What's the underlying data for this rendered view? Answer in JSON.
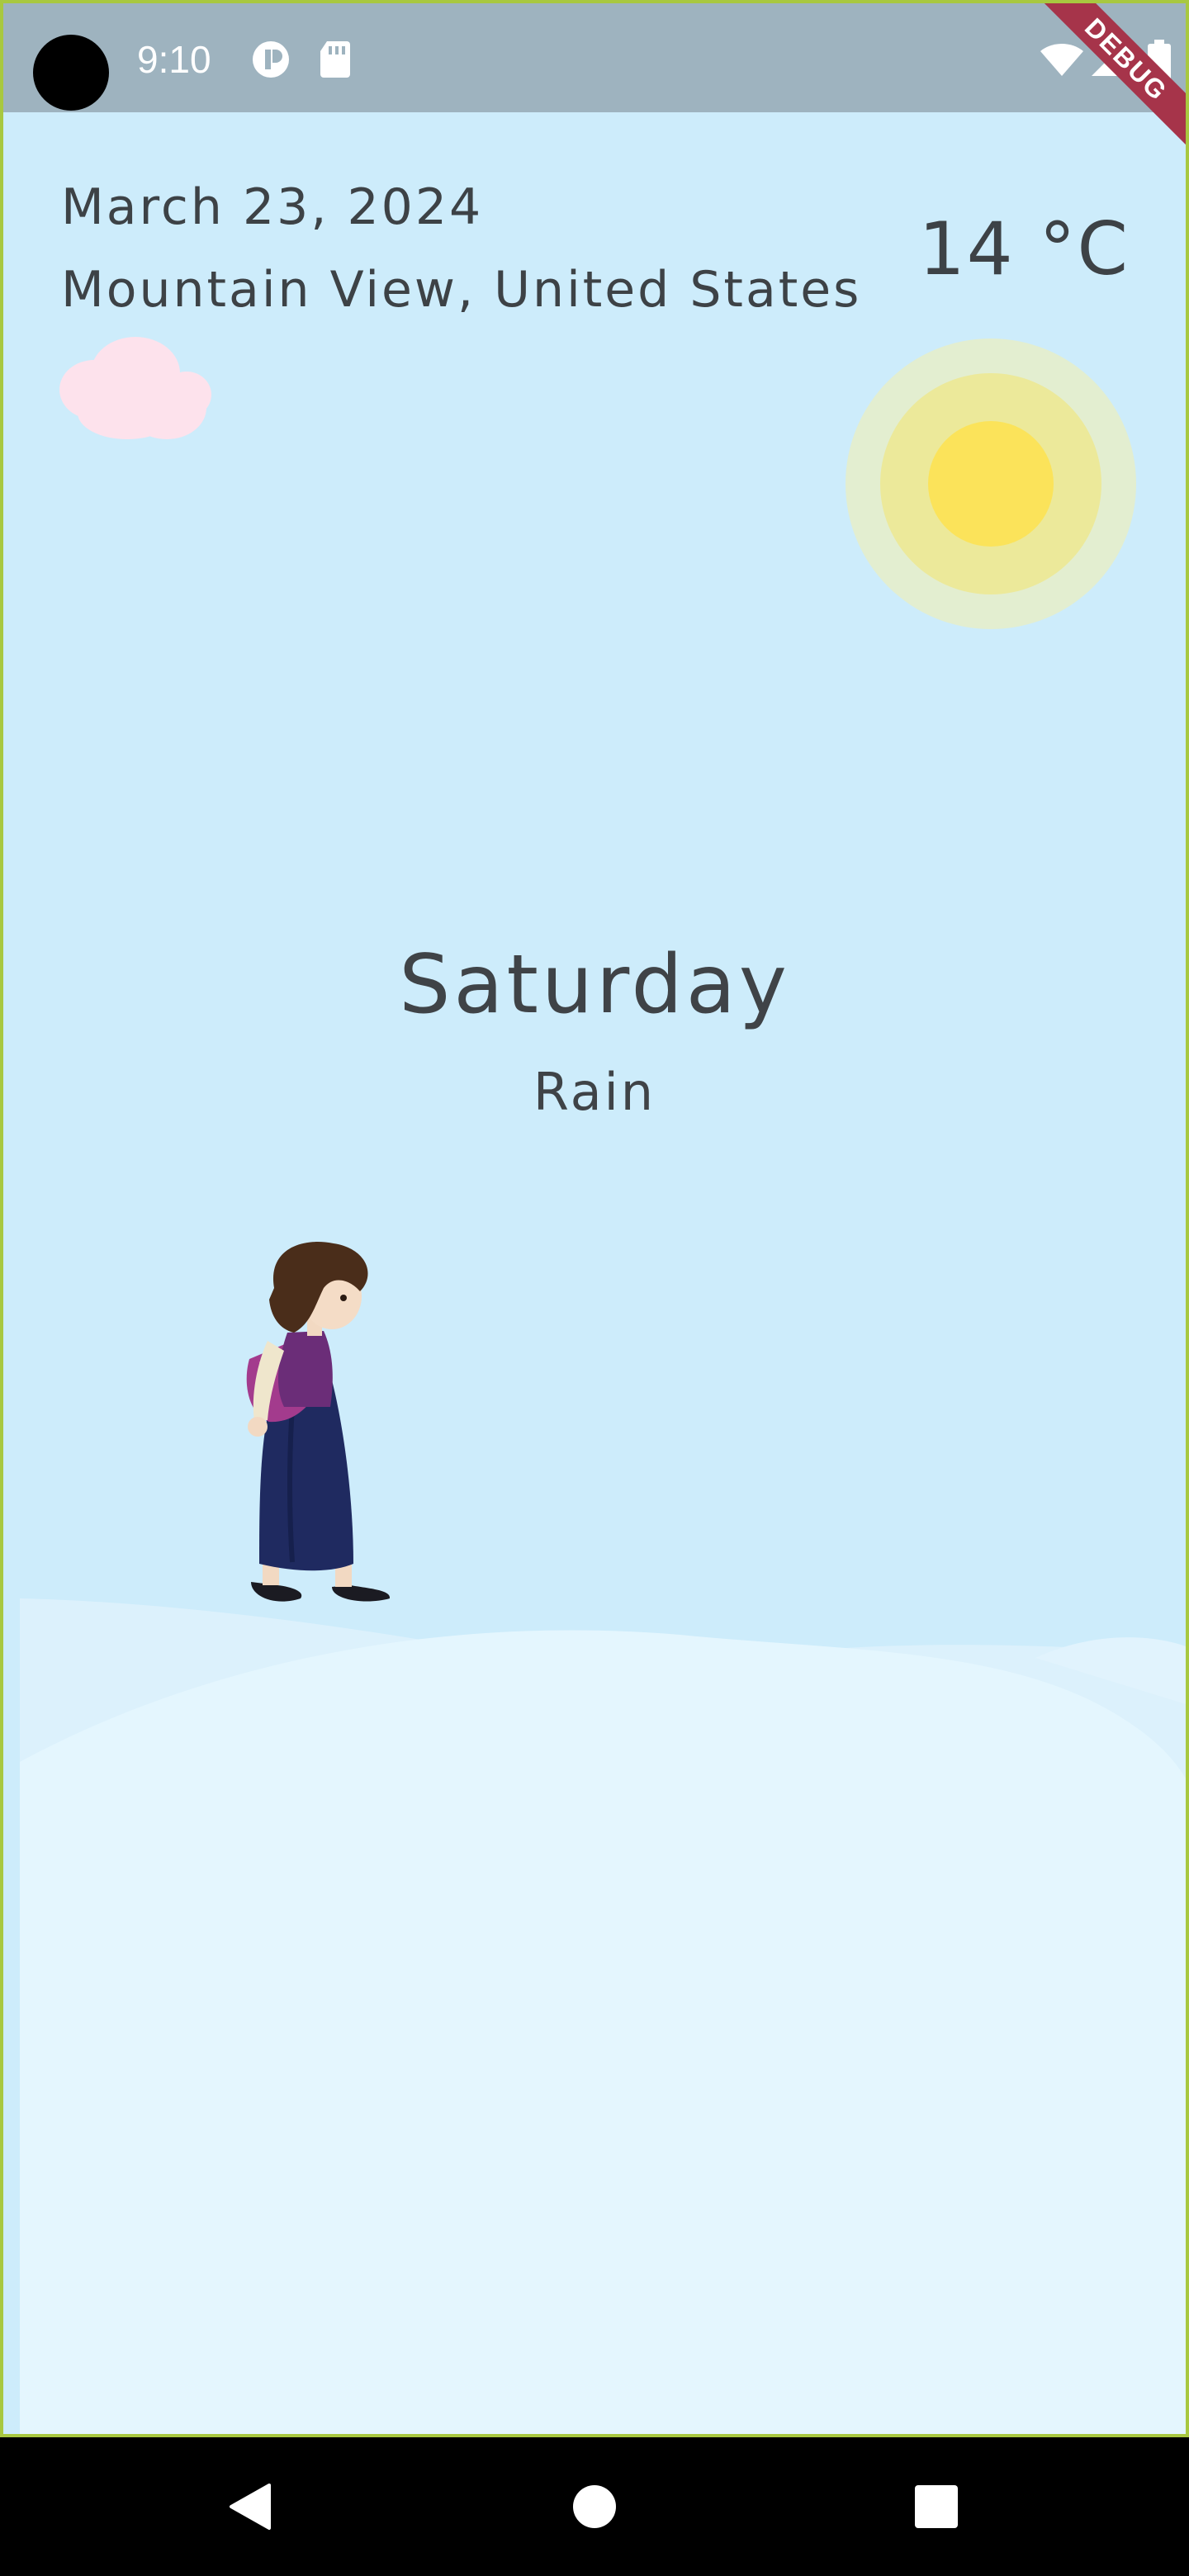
{
  "status_bar": {
    "time": "9:10",
    "icons": [
      "camera-cutout",
      "notification-app-icon",
      "sd-card-icon",
      "wifi-icon",
      "signal-icon",
      "battery-icon"
    ]
  },
  "debug_banner": "DEBUG",
  "weather": {
    "date": "March 23, 2024",
    "location": "Mountain View, United States",
    "temperature": "14 °C",
    "day": "Saturday",
    "condition": "Rain"
  },
  "colors": {
    "sky": "#cdecfb",
    "ground": "#e3f5fd",
    "sun": "#fbe35a",
    "cloud": "#fde2ec",
    "text": "#3d4246",
    "status_bar": "#9eb3bf",
    "frame": "#a8c840"
  },
  "nav_bar": {
    "icons": [
      "back-icon",
      "home-icon",
      "recents-icon"
    ]
  }
}
